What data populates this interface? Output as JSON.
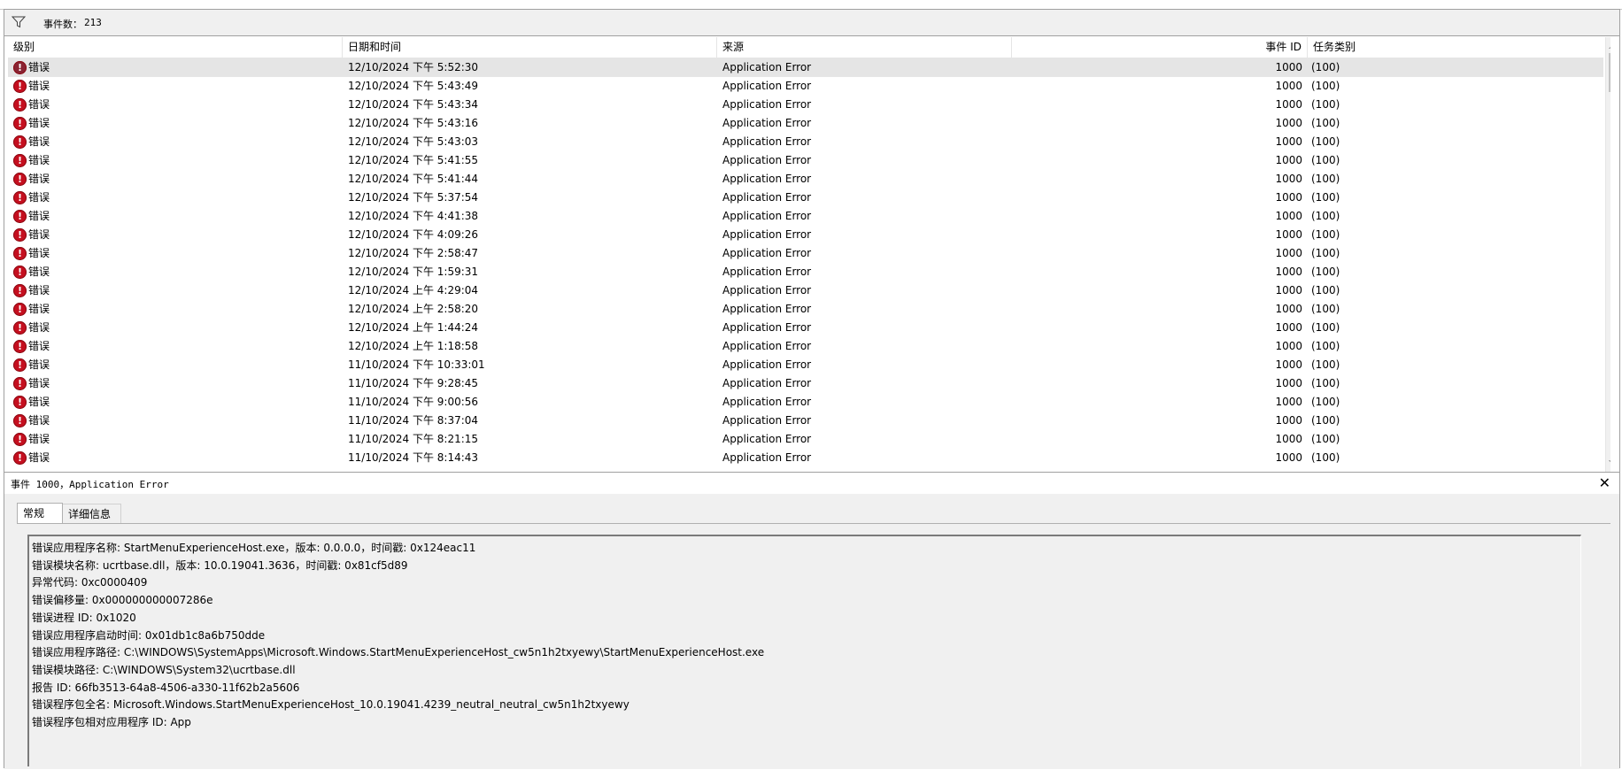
{
  "filter": {
    "count_label": "事件数：",
    "count_value": "213"
  },
  "columns": {
    "level": "级别",
    "datetime": "日期和时间",
    "source": "来源",
    "event_id": "事件 ID",
    "task": "任务类别"
  },
  "rows": [
    {
      "level": "错误",
      "datetime": "12/10/2024 下午 5:52:30",
      "source": "Application Error",
      "event_id": "1000",
      "task": "(100)"
    },
    {
      "level": "错误",
      "datetime": "12/10/2024 下午 5:43:49",
      "source": "Application Error",
      "event_id": "1000",
      "task": "(100)"
    },
    {
      "level": "错误",
      "datetime": "12/10/2024 下午 5:43:34",
      "source": "Application Error",
      "event_id": "1000",
      "task": "(100)"
    },
    {
      "level": "错误",
      "datetime": "12/10/2024 下午 5:43:16",
      "source": "Application Error",
      "event_id": "1000",
      "task": "(100)"
    },
    {
      "level": "错误",
      "datetime": "12/10/2024 下午 5:43:03",
      "source": "Application Error",
      "event_id": "1000",
      "task": "(100)"
    },
    {
      "level": "错误",
      "datetime": "12/10/2024 下午 5:41:55",
      "source": "Application Error",
      "event_id": "1000",
      "task": "(100)"
    },
    {
      "level": "错误",
      "datetime": "12/10/2024 下午 5:41:44",
      "source": "Application Error",
      "event_id": "1000",
      "task": "(100)"
    },
    {
      "level": "错误",
      "datetime": "12/10/2024 下午 5:37:54",
      "source": "Application Error",
      "event_id": "1000",
      "task": "(100)"
    },
    {
      "level": "错误",
      "datetime": "12/10/2024 下午 4:41:38",
      "source": "Application Error",
      "event_id": "1000",
      "task": "(100)"
    },
    {
      "level": "错误",
      "datetime": "12/10/2024 下午 4:09:26",
      "source": "Application Error",
      "event_id": "1000",
      "task": "(100)"
    },
    {
      "level": "错误",
      "datetime": "12/10/2024 下午 2:58:47",
      "source": "Application Error",
      "event_id": "1000",
      "task": "(100)"
    },
    {
      "level": "错误",
      "datetime": "12/10/2024 下午 1:59:31",
      "source": "Application Error",
      "event_id": "1000",
      "task": "(100)"
    },
    {
      "level": "错误",
      "datetime": "12/10/2024 上午 4:29:04",
      "source": "Application Error",
      "event_id": "1000",
      "task": "(100)"
    },
    {
      "level": "错误",
      "datetime": "12/10/2024 上午 2:58:20",
      "source": "Application Error",
      "event_id": "1000",
      "task": "(100)"
    },
    {
      "level": "错误",
      "datetime": "12/10/2024 上午 1:44:24",
      "source": "Application Error",
      "event_id": "1000",
      "task": "(100)"
    },
    {
      "level": "错误",
      "datetime": "12/10/2024 上午 1:18:58",
      "source": "Application Error",
      "event_id": "1000",
      "task": "(100)"
    },
    {
      "level": "错误",
      "datetime": "11/10/2024 下午 10:33:01",
      "source": "Application Error",
      "event_id": "1000",
      "task": "(100)"
    },
    {
      "level": "错误",
      "datetime": "11/10/2024 下午 9:28:45",
      "source": "Application Error",
      "event_id": "1000",
      "task": "(100)"
    },
    {
      "level": "错误",
      "datetime": "11/10/2024 下午 9:00:56",
      "source": "Application Error",
      "event_id": "1000",
      "task": "(100)"
    },
    {
      "level": "错误",
      "datetime": "11/10/2024 下午 8:37:04",
      "source": "Application Error",
      "event_id": "1000",
      "task": "(100)"
    },
    {
      "level": "错误",
      "datetime": "11/10/2024 下午 8:21:15",
      "source": "Application Error",
      "event_id": "1000",
      "task": "(100)"
    },
    {
      "level": "错误",
      "datetime": "11/10/2024 下午 8:14:43",
      "source": "Application Error",
      "event_id": "1000",
      "task": "(100)"
    }
  ],
  "detail": {
    "title": "事件 1000，Application Error",
    "tabs": [
      "常规",
      "详细信息"
    ],
    "lines": [
      "错误应用程序名称: StartMenuExperienceHost.exe，版本: 0.0.0.0，时间戳: 0x124eac11",
      "错误模块名称: ucrtbase.dll，版本: 10.0.19041.3636，时间戳: 0x81cf5d89",
      "异常代码: 0xc0000409",
      "错误偏移量: 0x000000000007286e",
      "错误进程 ID: 0x1020",
      "错误应用程序启动时间: 0x01db1c8a6b750dde",
      "错误应用程序路径: C:\\WINDOWS\\SystemApps\\Microsoft.Windows.StartMenuExperienceHost_cw5n1h2txyewy\\StartMenuExperienceHost.exe",
      "错误模块路径: C:\\WINDOWS\\System32\\ucrtbase.dll",
      "报告 ID: 66fb3513-64a8-4506-a330-11f62b2a5606",
      "错误程序包全名: Microsoft.Windows.StartMenuExperienceHost_10.0.19041.4239_neutral_neutral_cw5n1h2txyewy",
      "错误程序包相对应用程序 ID: App"
    ]
  },
  "icons": {
    "filter": "filter-icon",
    "error": "error-icon",
    "close": "close-icon",
    "up": "scroll-up-arrow",
    "down": "scroll-down-arrow"
  },
  "colors": {
    "error": "#c50f1f",
    "selected_row": "#e5e5e5",
    "panel_bg": "#f0f0f0"
  }
}
